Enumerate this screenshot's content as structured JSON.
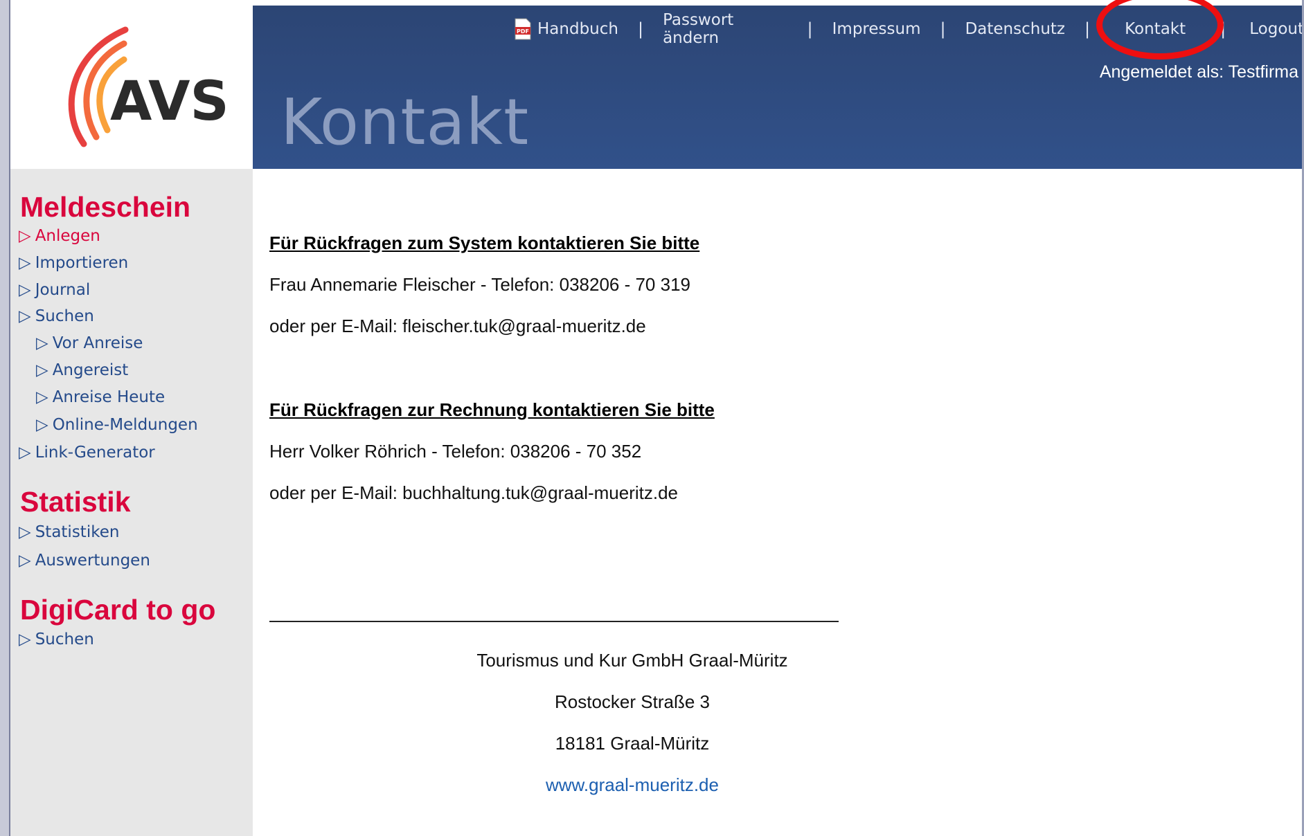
{
  "logo": {
    "text": "AVS"
  },
  "topnav": {
    "items": [
      {
        "label": "Handbuch",
        "icon": "pdf-icon"
      },
      {
        "label": "Passwort ändern"
      },
      {
        "label": "Impressum"
      },
      {
        "label": "Datenschutz"
      },
      {
        "label": "Kontakt"
      },
      {
        "label": "Logout"
      }
    ],
    "separator": "|",
    "login_info": "Angemeldet als: Testfirma"
  },
  "page_title": "Kontakt",
  "sidebar": {
    "sections": [
      {
        "title": "Meldeschein",
        "items": [
          {
            "label": "Anlegen",
            "active": true
          },
          {
            "label": "Importieren"
          },
          {
            "label": "Journal"
          },
          {
            "label": "Suchen"
          },
          {
            "label": "Vor Anreise",
            "sub": true
          },
          {
            "label": "Angereist",
            "sub": true
          },
          {
            "label": "Anreise Heute",
            "sub": true
          },
          {
            "label": "Online-Meldungen",
            "sub": true
          },
          {
            "label": "Link-Generator"
          }
        ]
      },
      {
        "title": "Statistik",
        "items": [
          {
            "label": "Statistiken"
          },
          {
            "label": "Auswertungen"
          }
        ]
      },
      {
        "title": "DigiCard to go",
        "items": [
          {
            "label": "Suchen"
          }
        ]
      }
    ]
  },
  "content": {
    "system": {
      "heading": "Für Rückfragen zum System kontaktieren Sie bitte",
      "person": "Frau Annemarie Fleischer - Telefon: 038206 - 70 319",
      "email": "oder per E-Mail: fleischer.tuk@graal-mueritz.de"
    },
    "billing": {
      "heading": "Für Rückfragen zur Rechnung kontaktieren Sie bitte",
      "person": "Herr Volker Röhrich - Telefon: 038206 - 70 352",
      "email": "oder per E-Mail: buchhaltung.tuk@graal-mueritz.de"
    },
    "footer": {
      "company": "Tourismus und Kur GmbH Graal-Müritz",
      "street": "Rostocker Straße 3",
      "city": "18181 Graal-Müritz",
      "website": "www.graal-mueritz.de"
    }
  },
  "colors": {
    "header_bg": "#2e4a7e",
    "sidebar_bg": "#e7e7e7",
    "section_red": "#d9063d",
    "link_blue": "#244a8a",
    "highlight_circle": "#ee0f10"
  }
}
